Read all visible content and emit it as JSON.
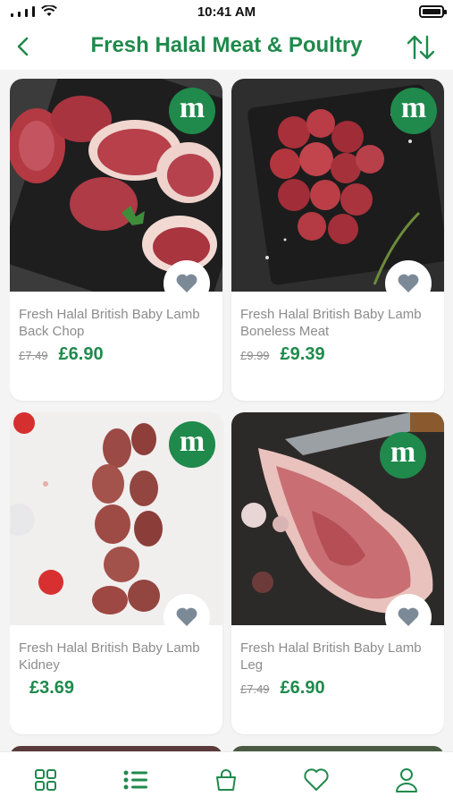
{
  "status_bar": {
    "time": "10:41 AM"
  },
  "header": {
    "title": "Fresh Halal Meat & Poultry",
    "back_icon": "chevron-left-icon",
    "sort_icon": "sort-arrows-icon"
  },
  "brand": {
    "badge_letter": "m",
    "accent_color": "#1f8a4c"
  },
  "products": [
    {
      "name": "Fresh Halal British Baby Lamb Back Chop",
      "old_price": "£7.49",
      "price": "£6.90"
    },
    {
      "name": "Fresh Halal British Baby Lamb Boneless Meat",
      "old_price": "£9.99",
      "price": "£9.39"
    },
    {
      "name": "Fresh Halal British Baby Lamb Kidney",
      "old_price": "",
      "price": "£3.69"
    },
    {
      "name": "Fresh Halal British Baby Lamb Leg",
      "old_price": "£7.49",
      "price": "£6.90"
    }
  ],
  "bottom_nav": {
    "items": [
      "grid-icon",
      "list-icon",
      "bag-icon",
      "heart-icon",
      "user-icon"
    ],
    "active": "list-icon"
  }
}
